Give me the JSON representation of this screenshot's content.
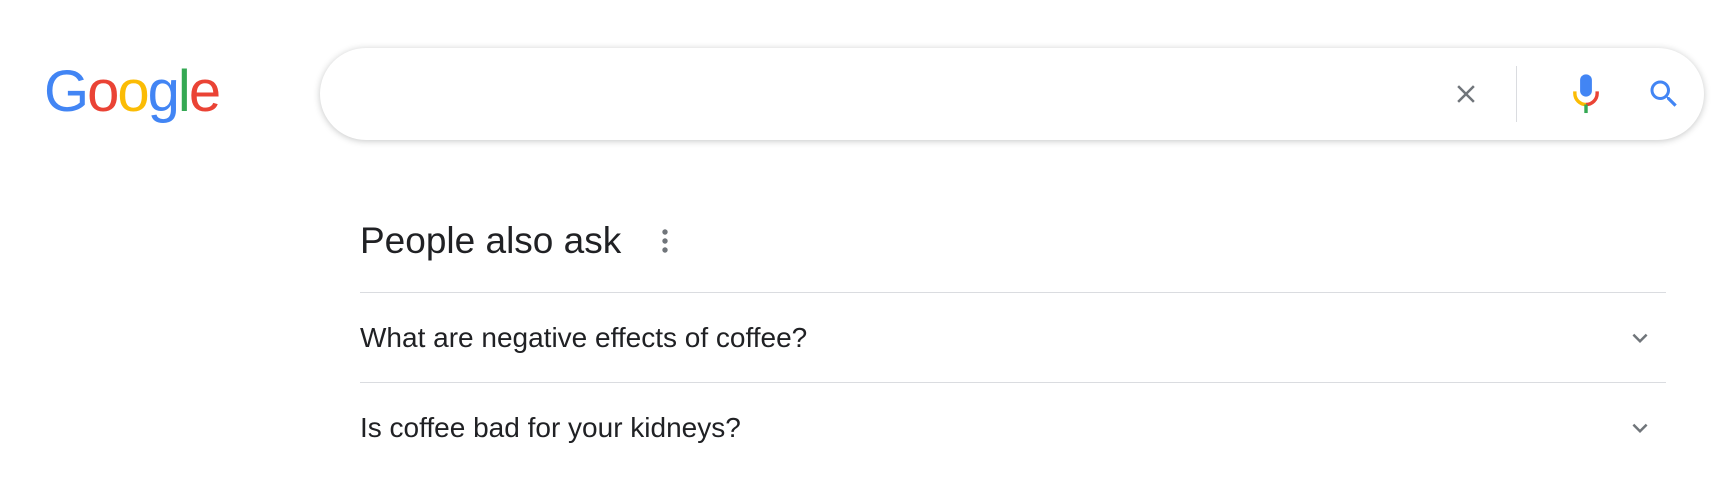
{
  "logo": {
    "letters": [
      "G",
      "o",
      "o",
      "g",
      "l",
      "e"
    ],
    "colors": [
      "#4285F4",
      "#EA4335",
      "#FBBC05",
      "#4285F4",
      "#34A853",
      "#EA4335"
    ]
  },
  "search": {
    "value": "",
    "placeholder": "",
    "clear_icon": "close-icon",
    "mic_icon": "microphone-icon",
    "search_icon": "search-icon",
    "accent_color": "#4285F4"
  },
  "people_also_ask": {
    "title": "People also ask",
    "menu_icon": "more-vert-icon",
    "questions": [
      {
        "text": "What are negative effects of coffee?",
        "icon": "chevron-down-icon"
      },
      {
        "text": "Is coffee bad for your kidneys?",
        "icon": "chevron-down-icon"
      }
    ]
  },
  "colors": {
    "text": "#202124",
    "icon_gray": "#70757a",
    "divider": "#dadce0"
  }
}
